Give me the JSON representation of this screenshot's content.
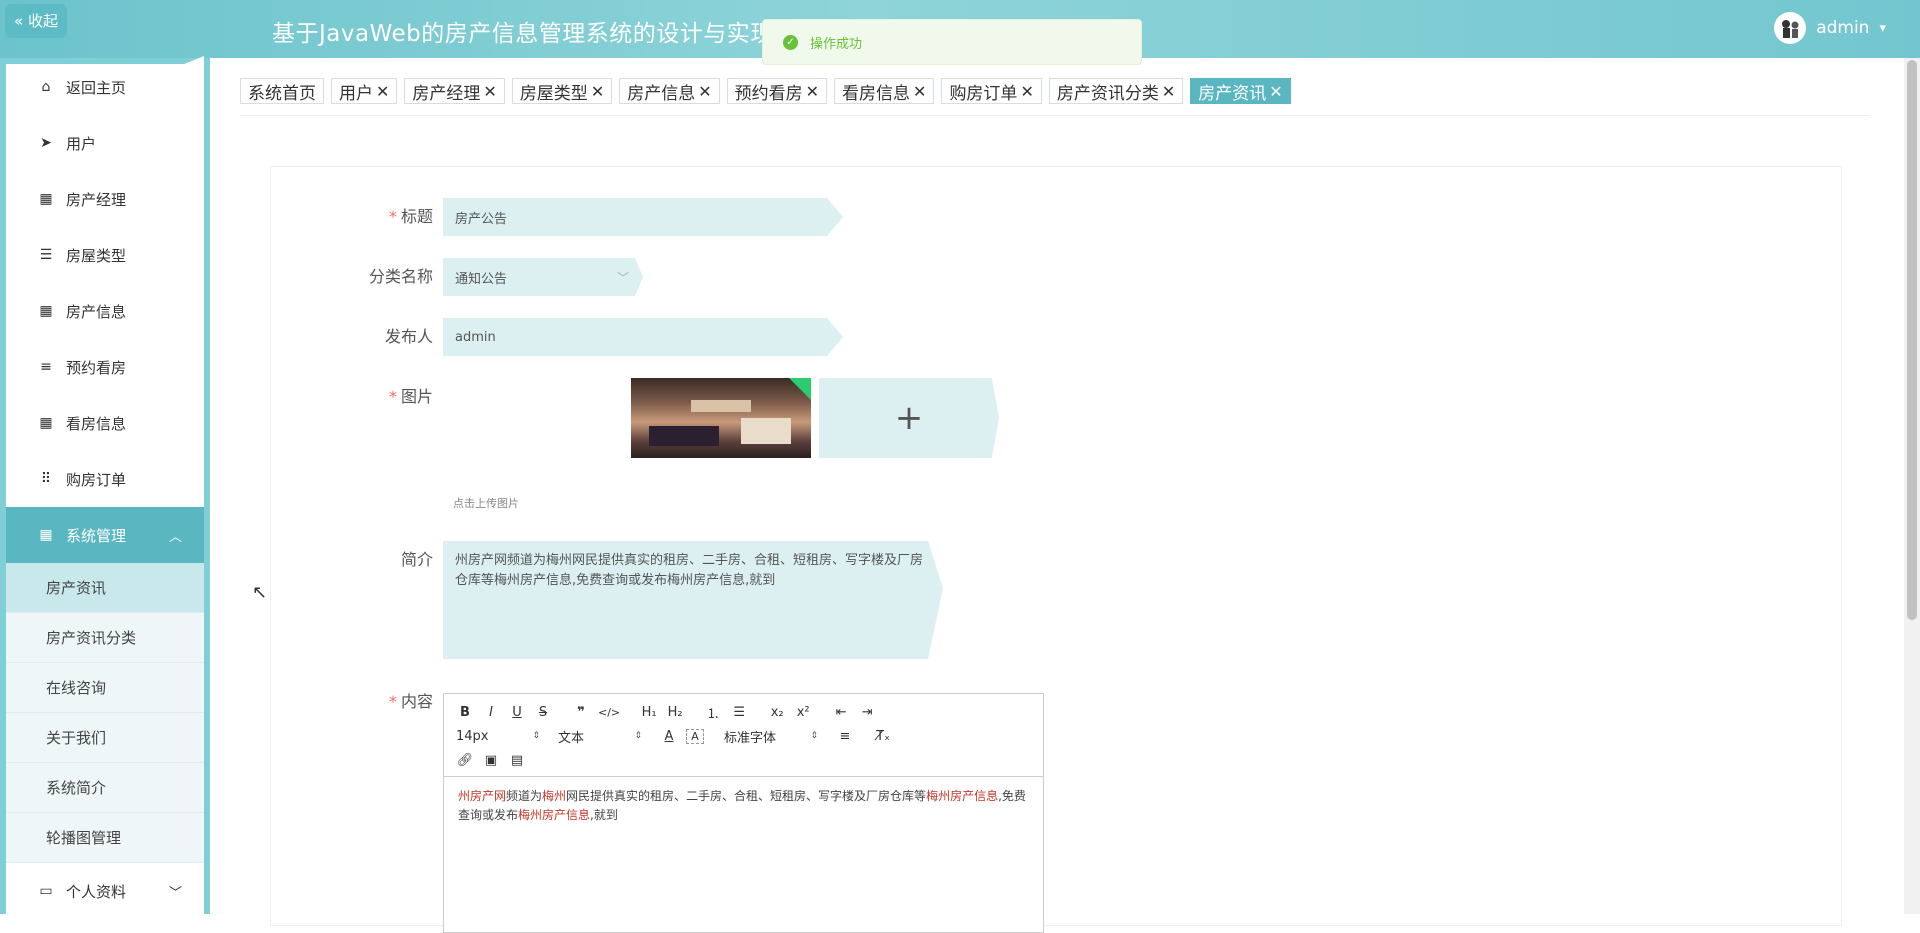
{
  "header": {
    "collapse_label": "« 收起",
    "title": "基于JavaWeb的房产信息管理系统的设计与实现",
    "user_name": "admin",
    "user_caret": "⌄"
  },
  "toast": {
    "message": "操作成功"
  },
  "sidebar": {
    "items": [
      {
        "label": "返回主页",
        "icon": "home-icon"
      },
      {
        "label": "用户",
        "icon": "send-icon"
      },
      {
        "label": "房产经理",
        "icon": "grid-icon"
      },
      {
        "label": "房屋类型",
        "icon": "sliders-icon"
      },
      {
        "label": "房产信息",
        "icon": "grid-icon"
      },
      {
        "label": "预约看房",
        "icon": "list-icon"
      },
      {
        "label": "看房信息",
        "icon": "grid-icon"
      },
      {
        "label": "购房订单",
        "icon": "dots-grid-icon"
      },
      {
        "label": "系统管理",
        "icon": "grid-icon"
      }
    ],
    "submenu": [
      {
        "label": "房产资讯"
      },
      {
        "label": "房产资讯分类"
      },
      {
        "label": "在线咨询"
      },
      {
        "label": "关于我们"
      },
      {
        "label": "系统简介"
      },
      {
        "label": "轮播图管理"
      }
    ],
    "profile": {
      "label": "个人资料",
      "icon": "id-card-icon"
    }
  },
  "tags": [
    {
      "label": "系统首页",
      "closable": false
    },
    {
      "label": "用户",
      "closable": true
    },
    {
      "label": "房产经理",
      "closable": true
    },
    {
      "label": "房屋类型",
      "closable": true
    },
    {
      "label": "房产信息",
      "closable": true
    },
    {
      "label": "预约看房",
      "closable": true
    },
    {
      "label": "看房信息",
      "closable": true
    },
    {
      "label": "购房订单",
      "closable": true
    },
    {
      "label": "房产资讯分类",
      "closable": true
    },
    {
      "label": "房产资讯",
      "closable": true,
      "active": true
    }
  ],
  "form": {
    "title_label": "标题",
    "title_value": "房产公告",
    "category_label": "分类名称",
    "category_value": "通知公告",
    "publisher_label": "发布人",
    "publisher_value": "admin",
    "image_label": "图片",
    "upload_hint": "点击上传图片",
    "summary_label": "简介",
    "summary_value": "州房产网频道为梅州网民提供真实的租房、二手房、合租、短租房、写字楼及厂房仓库等梅州房产信息,免费查询或发布梅州房产信息,就到",
    "content_label": "内容",
    "required_mark": "*"
  },
  "editor": {
    "font_size": "14px",
    "paragraph": "文本",
    "font_family": "标准字体",
    "content_segments": [
      {
        "text": "州房产网",
        "highlight": true
      },
      {
        "text": "频道为",
        "highlight": false
      },
      {
        "text": "梅州",
        "highlight": true
      },
      {
        "text": "网民提供真实的租房、二手房、合租、短租房、写字楼及厂房仓库等",
        "highlight": false
      },
      {
        "text": "梅州房产信息",
        "highlight": true
      },
      {
        "text": ",免费查询或发布",
        "highlight": false
      },
      {
        "text": "梅州房产信息",
        "highlight": true
      },
      {
        "text": ",就到",
        "highlight": false
      }
    ]
  },
  "colors": {
    "accent": "#5ab7c2",
    "header": "#7fcfd6",
    "input_bg": "#dcf0f2",
    "required": "#f56c6c",
    "success": "#67c23a",
    "editor_highlight": "#c0392b"
  }
}
